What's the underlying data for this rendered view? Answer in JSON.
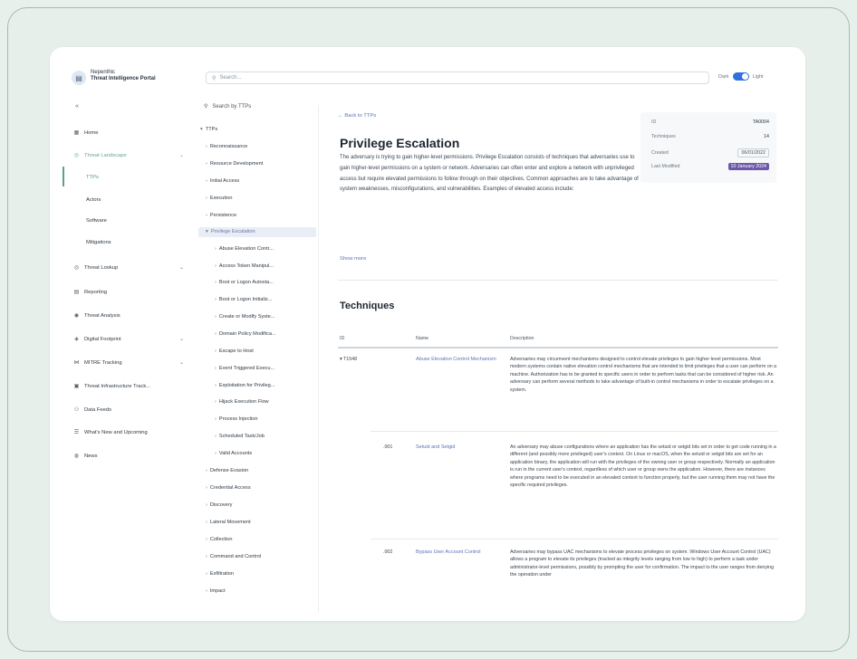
{
  "app": {
    "name_line1": "Nepenthic",
    "name_line2": "Threat Intelligence Portal",
    "logo_glyph": "▤",
    "search_placeholder": "Search...",
    "theme_dark": "Dark",
    "theme_light": "Light"
  },
  "sidebar": {
    "collapse_glyph": "«",
    "items": [
      {
        "label": "Home",
        "icon": "▦"
      },
      {
        "label": "Threat Landscape",
        "icon": "◎",
        "chev": "⌄"
      },
      {
        "label": "Threat Lookup",
        "icon": "◎",
        "chev": "⌄"
      },
      {
        "label": "Reporting",
        "icon": "▤"
      },
      {
        "label": "Threat Analysis",
        "icon": "◉"
      },
      {
        "label": "Digital Footprint",
        "icon": "◈",
        "chev": "⌄"
      },
      {
        "label": "MITRE Tracking",
        "icon": "⋈",
        "chev": "⌄"
      },
      {
        "label": "Threat Infrastructure Track...",
        "icon": "▣"
      },
      {
        "label": "Data Feeds",
        "icon": "⚇"
      },
      {
        "label": "What's New and Upcoming",
        "icon": "☰"
      },
      {
        "label": "News",
        "icon": "◍"
      }
    ],
    "subitems": [
      "TTPs",
      "Actors",
      "Software",
      "Mitigations"
    ]
  },
  "tree": {
    "search_label": "Search by TTPs",
    "root": "TTPs",
    "items": [
      "Reconnaissance",
      "Resource Development",
      "Initial Access",
      "Execution",
      "Persistence",
      "Privilege Escalation",
      "Defense Evasion",
      "Credential Access",
      "Discovery",
      "Lateral Movement",
      "Collection",
      "Command and Control",
      "Exfiltration",
      "Impact"
    ],
    "children": [
      "Abuse Elevation Contr...",
      "Access Token Manipul...",
      "Boot or Logon Autosta...",
      "Boot or Logon Initializ...",
      "Create or Modify Syste...",
      "Domain Policy Modifica...",
      "Escape to Host",
      "Event Triggered Execu...",
      "Exploitation for Privileg...",
      "Hijack Execution Flow",
      "Process Injection",
      "Scheduled Task/Job",
      "Valid Accounts"
    ]
  },
  "content": {
    "back_link": "← Back to TTPs",
    "title": "Privilege Escalation",
    "description": "The adversary is trying to gain higher-level permissions. Privilege Escalation consists of techniques that adversaries use to gain higher-level permissions on a system or network. Adversaries can often enter and explore a network with unprivileged access but require elevated permissions to follow through on their objectives. Common approaches are to take advantage of system weaknesses, misconfigurations, and vulnerabilities. Examples of elevated access include:",
    "show_more": "Show more",
    "meta": {
      "id_label": "ID",
      "id_value": "TA0004",
      "tech_label": "Techniques",
      "tech_value": "14",
      "created_label": "Created",
      "created_value": "06/01/2022",
      "modified_label": "Last Modified",
      "modified_value": "10 January 2024"
    },
    "techniques_heading": "Techniques",
    "table": {
      "headers": [
        "ID",
        "Name",
        "Description"
      ],
      "rows": [
        {
          "id": "▾ T1548",
          "name": "Abuse Elevation Control Mechanism",
          "description": "Adversaries may circumvent mechanisms designed to control elevate privileges to gain higher-level permissions. Most modern systems contain native elevation control mechanisms that are intended to limit privileges that a user can perform on a machine. Authorization has to be granted to specific users in order to perform tasks that can be considered of higher risk. An adversary can perform several methods to take advantage of built-in control mechanisms in order to escalate privileges on a system."
        },
        {
          "id": ".001",
          "name": "Setuid and Setgid",
          "description": "An adversary may abuse configurations where an application has the setuid or setgid bits set in order to get code running in a different (and possibly more privileged) user's context. On Linux or macOS, when the setuid or setgid bits are set for an application binary, the application will run with the privileges of the owning user or group respectively. Normally an application is run in the current user's context, regardless of which user or group owns the application. However, there are instances where programs need to be executed in an elevated context to function properly, but the user running them may not have the specific required privileges."
        },
        {
          "id": ".002",
          "name": "Bypass User Account Control",
          "description": "Adversaries may bypass UAC mechanisms to elevate process privileges on system. Windows User Account Control (UAC) allows a program to elevate its privileges (tracked as integrity levels ranging from low to high) to perform a task under administrator-level permissions, possibly by prompting the user for confirmation. The impact to the user ranges from denying the operation under"
        }
      ]
    }
  }
}
